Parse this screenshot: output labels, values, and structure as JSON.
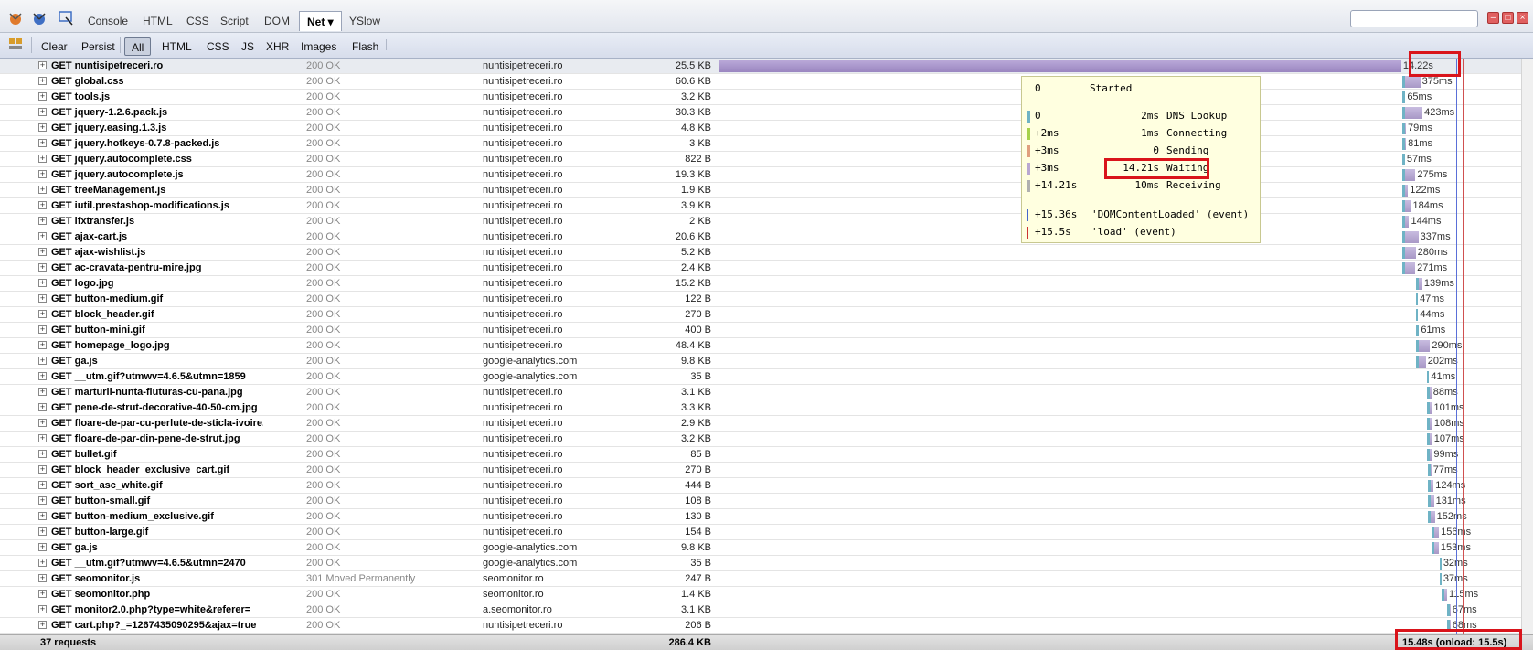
{
  "toolbar": {
    "tabs": [
      "Console",
      "HTML",
      "CSS",
      "Script",
      "DOM",
      "Net ▾",
      "YSlow"
    ],
    "active_tab": "Net ▾"
  },
  "filters": {
    "buttons": [
      "Clear",
      "Persist",
      "All",
      "HTML",
      "CSS",
      "JS",
      "XHR",
      "Images",
      "Flash"
    ],
    "active": "All"
  },
  "requests": [
    {
      "url": "GET nuntisipetreceri.ro",
      "status": "200 OK",
      "domain": "nuntisipetreceri.ro",
      "size": "25.5 KB",
      "time": "14.22s",
      "start": 0,
      "dur": 14.22
    },
    {
      "url": "GET global.css",
      "status": "200 OK",
      "domain": "nuntisipetreceri.ro",
      "size": "60.6 KB",
      "time": "375ms",
      "start": 14.24,
      "dur": 0.375
    },
    {
      "url": "GET tools.js",
      "status": "200 OK",
      "domain": "nuntisipetreceri.ro",
      "size": "3.2 KB",
      "time": "65ms",
      "start": 14.24,
      "dur": 0.065
    },
    {
      "url": "GET jquery-1.2.6.pack.js",
      "status": "200 OK",
      "domain": "nuntisipetreceri.ro",
      "size": "30.3 KB",
      "time": "423ms",
      "start": 14.24,
      "dur": 0.423
    },
    {
      "url": "GET jquery.easing.1.3.js",
      "status": "200 OK",
      "domain": "nuntisipetreceri.ro",
      "size": "4.8 KB",
      "time": "79ms",
      "start": 14.24,
      "dur": 0.079
    },
    {
      "url": "GET jquery.hotkeys-0.7.8-packed.js",
      "status": "200 OK",
      "domain": "nuntisipetreceri.ro",
      "size": "3 KB",
      "time": "81ms",
      "start": 14.24,
      "dur": 0.081
    },
    {
      "url": "GET jquery.autocomplete.css",
      "status": "200 OK",
      "domain": "nuntisipetreceri.ro",
      "size": "822 B",
      "time": "57ms",
      "start": 14.24,
      "dur": 0.057
    },
    {
      "url": "GET jquery.autocomplete.js",
      "status": "200 OK",
      "domain": "nuntisipetreceri.ro",
      "size": "19.3 KB",
      "time": "275ms",
      "start": 14.24,
      "dur": 0.275
    },
    {
      "url": "GET treeManagement.js",
      "status": "200 OK",
      "domain": "nuntisipetreceri.ro",
      "size": "1.9 KB",
      "time": "122ms",
      "start": 14.24,
      "dur": 0.122
    },
    {
      "url": "GET iutil.prestashop-modifications.js",
      "status": "200 OK",
      "domain": "nuntisipetreceri.ro",
      "size": "3.9 KB",
      "time": "184ms",
      "start": 14.24,
      "dur": 0.184
    },
    {
      "url": "GET ifxtransfer.js",
      "status": "200 OK",
      "domain": "nuntisipetreceri.ro",
      "size": "2 KB",
      "time": "144ms",
      "start": 14.24,
      "dur": 0.144
    },
    {
      "url": "GET ajax-cart.js",
      "status": "200 OK",
      "domain": "nuntisipetreceri.ro",
      "size": "20.6 KB",
      "time": "337ms",
      "start": 14.24,
      "dur": 0.337
    },
    {
      "url": "GET ajax-wishlist.js",
      "status": "200 OK",
      "domain": "nuntisipetreceri.ro",
      "size": "5.2 KB",
      "time": "280ms",
      "start": 14.24,
      "dur": 0.28
    },
    {
      "url": "GET ac-cravata-pentru-mire.jpg",
      "status": "200 OK",
      "domain": "nuntisipetreceri.ro",
      "size": "2.4 KB",
      "time": "271ms",
      "start": 14.24,
      "dur": 0.271
    },
    {
      "url": "GET logo.jpg",
      "status": "200 OK",
      "domain": "nuntisipetreceri.ro",
      "size": "15.2 KB",
      "time": "139ms",
      "start": 14.52,
      "dur": 0.139
    },
    {
      "url": "GET button-medium.gif",
      "status": "200 OK",
      "domain": "nuntisipetreceri.ro",
      "size": "122 B",
      "time": "47ms",
      "start": 14.52,
      "dur": 0.047
    },
    {
      "url": "GET block_header.gif",
      "status": "200 OK",
      "domain": "nuntisipetreceri.ro",
      "size": "270 B",
      "time": "44ms",
      "start": 14.53,
      "dur": 0.044
    },
    {
      "url": "GET button-mini.gif",
      "status": "200 OK",
      "domain": "nuntisipetreceri.ro",
      "size": "400 B",
      "time": "61ms",
      "start": 14.53,
      "dur": 0.061
    },
    {
      "url": "GET homepage_logo.jpg",
      "status": "200 OK",
      "domain": "nuntisipetreceri.ro",
      "size": "48.4 KB",
      "time": "290ms",
      "start": 14.53,
      "dur": 0.29
    },
    {
      "url": "GET ga.js",
      "status": "200 OK",
      "domain": "google-analytics.com",
      "size": "9.8 KB",
      "time": "202ms",
      "start": 14.53,
      "dur": 0.202
    },
    {
      "url": "GET __utm.gif?utmwv=4.6.5&utmn=1859",
      "status": "200 OK",
      "domain": "google-analytics.com",
      "size": "35 B",
      "time": "41ms",
      "start": 14.76,
      "dur": 0.041
    },
    {
      "url": "GET marturii-nunta-fluturas-cu-pana.jpg",
      "status": "200 OK",
      "domain": "nuntisipetreceri.ro",
      "size": "3.1 KB",
      "time": "88ms",
      "start": 14.76,
      "dur": 0.088
    },
    {
      "url": "GET pene-de-strut-decorative-40-50-cm.jpg",
      "status": "200 OK",
      "domain": "nuntisipetreceri.ro",
      "size": "3.3 KB",
      "time": "101ms",
      "start": 14.76,
      "dur": 0.101
    },
    {
      "url": "GET floare-de-par-cu-perlute-de-sticla-ivoire.jpg",
      "status": "200 OK",
      "domain": "nuntisipetreceri.ro",
      "size": "2.9 KB",
      "time": "108ms",
      "start": 14.76,
      "dur": 0.108
    },
    {
      "url": "GET floare-de-par-din-pene-de-strut.jpg",
      "status": "200 OK",
      "domain": "nuntisipetreceri.ro",
      "size": "3.2 KB",
      "time": "107ms",
      "start": 14.76,
      "dur": 0.107
    },
    {
      "url": "GET bullet.gif",
      "status": "200 OK",
      "domain": "nuntisipetreceri.ro",
      "size": "85 B",
      "time": "99ms",
      "start": 14.76,
      "dur": 0.099
    },
    {
      "url": "GET block_header_exclusive_cart.gif",
      "status": "200 OK",
      "domain": "nuntisipetreceri.ro",
      "size": "270 B",
      "time": "77ms",
      "start": 14.77,
      "dur": 0.077
    },
    {
      "url": "GET sort_asc_white.gif",
      "status": "200 OK",
      "domain": "nuntisipetreceri.ro",
      "size": "444 B",
      "time": "124ms",
      "start": 14.77,
      "dur": 0.124
    },
    {
      "url": "GET button-small.gif",
      "status": "200 OK",
      "domain": "nuntisipetreceri.ro",
      "size": "108 B",
      "time": "131ms",
      "start": 14.77,
      "dur": 0.131
    },
    {
      "url": "GET button-medium_exclusive.gif",
      "status": "200 OK",
      "domain": "nuntisipetreceri.ro",
      "size": "130 B",
      "time": "152ms",
      "start": 14.77,
      "dur": 0.152
    },
    {
      "url": "GET button-large.gif",
      "status": "200 OK",
      "domain": "nuntisipetreceri.ro",
      "size": "154 B",
      "time": "156ms",
      "start": 14.85,
      "dur": 0.156
    },
    {
      "url": "GET ga.js",
      "status": "200 OK",
      "domain": "google-analytics.com",
      "size": "9.8 KB",
      "time": "153ms",
      "start": 14.85,
      "dur": 0.153
    },
    {
      "url": "GET __utm.gif?utmwv=4.6.5&utmn=2470",
      "status": "200 OK",
      "domain": "google-analytics.com",
      "size": "35 B",
      "time": "32ms",
      "start": 15.02,
      "dur": 0.032
    },
    {
      "url": "GET seomonitor.js",
      "status": "301 Moved Permanently",
      "domain": "seomonitor.ro",
      "size": "247 B",
      "time": "37ms",
      "start": 15.02,
      "dur": 0.037
    },
    {
      "url": "GET seomonitor.php",
      "status": "200 OK",
      "domain": "seomonitor.ro",
      "size": "1.4 KB",
      "time": "115ms",
      "start": 15.06,
      "dur": 0.115
    },
    {
      "url": "GET monitor2.0.php?type=white&referer=",
      "status": "200 OK",
      "domain": "a.seomonitor.ro",
      "size": "3.1 KB",
      "time": "67ms",
      "start": 15.18,
      "dur": 0.067
    },
    {
      "url": "GET cart.php?_=1267435090295&ajax=true",
      "status": "200 OK",
      "domain": "nuntisipetreceri.ro",
      "size": "206 B",
      "time": "68ms",
      "start": 15.18,
      "dur": 0.068
    }
  ],
  "tooltip": {
    "started": [
      "0",
      "Started"
    ],
    "phases": [
      {
        "offset": "0",
        "time": "2ms",
        "label": "DNS Lookup",
        "color": "#6fb3c5"
      },
      {
        "offset": "+2ms",
        "time": "1ms",
        "label": "Connecting",
        "color": "#a6d24a"
      },
      {
        "offset": "+3ms",
        "time": "0",
        "label": "Sending",
        "color": "#e0a07e"
      },
      {
        "offset": "+3ms",
        "time": "14.21s",
        "label": "Waiting",
        "color": "#b9a8d2"
      },
      {
        "offset": "+14.21s",
        "time": "10ms",
        "label": "Receiving",
        "color": "#b0b0b0"
      }
    ],
    "events": [
      {
        "offset": "+15.36s",
        "label": "'DOMContentLoaded' (event)",
        "color": "#4466cc"
      },
      {
        "offset": "+15.5s",
        "label": "'load' (event)",
        "color": "#cc3333"
      }
    ]
  },
  "summary": {
    "requests": "37 requests",
    "size": "286.4 KB",
    "total": "15.48s (onload: 15.5s)"
  },
  "colors": {
    "waiting": "#a898c6",
    "dns": "#6fb3c5",
    "dom_line": "#5a6fd8",
    "load_line": "#d05050",
    "highlight": "#d9141b"
  }
}
